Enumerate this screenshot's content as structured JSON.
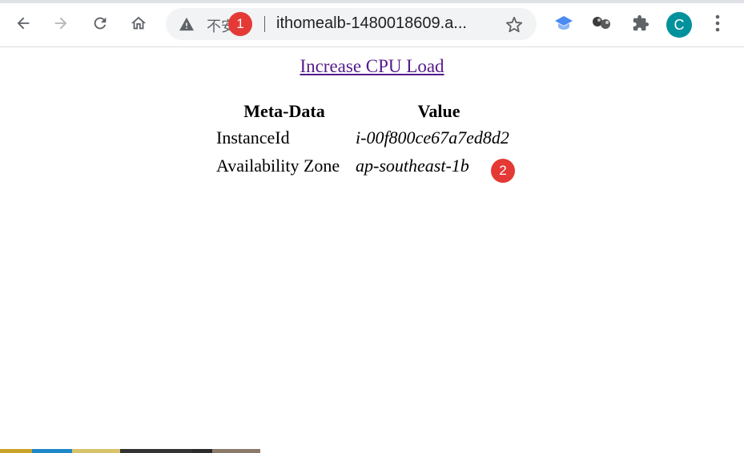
{
  "browser": {
    "address_bar": {
      "security_label": "不安全",
      "url": "ithomealb-1480018609.a..."
    },
    "profile_initial": "C"
  },
  "annotations": {
    "badge_1": "1",
    "badge_2": "2"
  },
  "page": {
    "link_text": "Increase CPU Load",
    "table": {
      "headers": [
        "Meta-Data",
        "Value"
      ],
      "rows": [
        [
          "InstanceId",
          "i-00f800ce67a7ed8d2"
        ],
        [
          "Availability Zone",
          "ap-southeast-1b"
        ]
      ]
    }
  },
  "colors": {
    "link": "#551a8b",
    "avatar": "#00929c",
    "badge": "#e53935",
    "omnibox": "#f1f3f4"
  }
}
